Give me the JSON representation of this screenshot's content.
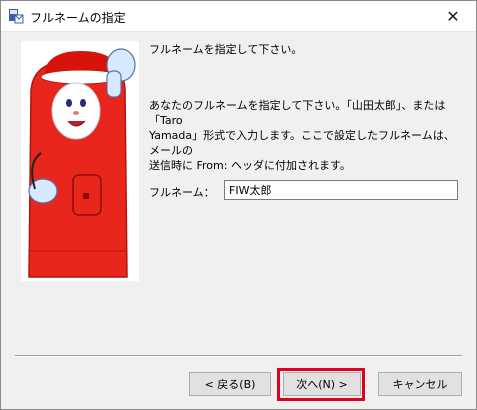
{
  "window": {
    "title": "フルネームの指定",
    "close_glyph": "✕"
  },
  "content": {
    "intro": "フルネームを指定して下さい。",
    "description": "あなたのフルネームを指定して下さい。「山田太郎」、または「Taro\nYamada」形式で入力します。ここで設定したフルネームは、メールの\n送信時に From: ヘッダに付加されます。",
    "full_name_label": "フルネーム：",
    "full_name_value": "FIW太郎"
  },
  "buttons": {
    "back": "< 戻る(B)",
    "next": "次へ(N) >",
    "cancel": "キャンセル"
  },
  "colors": {
    "highlight": "#e00022",
    "mascot_red": "#e8261c"
  },
  "icons": {
    "app": "mail-app-icon",
    "mascot": "mailbox-mascot",
    "close": "close-icon"
  }
}
